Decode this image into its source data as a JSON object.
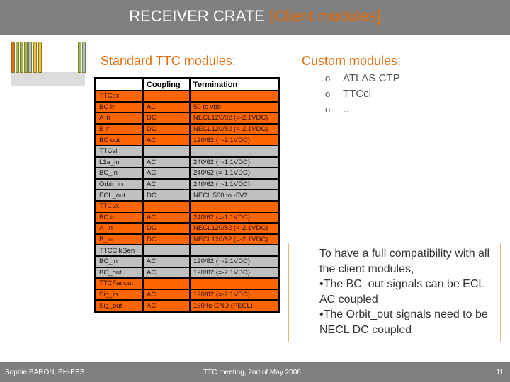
{
  "header": {
    "title_main": "RECEIVER CRATE",
    "title_accent": "[Client modules]"
  },
  "crate_image": {
    "icon": "vme-crate-illustration-icon",
    "slot_colors": [
      "#E46C0A",
      "#9BBB59",
      "#9BBB59",
      "#9BBB59",
      "#9DC3E6",
      "#F2C230",
      "#F2C230",
      "#9BBB59",
      "#9DC3E6"
    ]
  },
  "standard": {
    "heading": "Standard TTC modules:",
    "table": {
      "columns": [
        "",
        "Coupling",
        "Termination"
      ],
      "rows": [
        {
          "kind": "group",
          "color": "orange",
          "cells": [
            "TTCex",
            "",
            ""
          ]
        },
        {
          "kind": "signal",
          "color": "orange",
          "cells": [
            "BC in",
            "AC",
            "50 to vbb"
          ]
        },
        {
          "kind": "signal",
          "color": "orange",
          "cells": [
            "A in",
            "DC",
            "NECL120/82 (=-2.1VDC)"
          ]
        },
        {
          "kind": "signal",
          "color": "orange",
          "cells": [
            "B in",
            "DC",
            "NECL120/82 (=-2.1VDC)"
          ]
        },
        {
          "kind": "signal",
          "color": "orange",
          "cells": [
            "BC out",
            "AC",
            "120/82 (=-2.1VDC)"
          ]
        },
        {
          "kind": "group",
          "color": "gray",
          "cells": [
            "TTCvi",
            "",
            ""
          ]
        },
        {
          "kind": "signal",
          "color": "gray",
          "cells": [
            "L1a_in",
            "AC",
            "240/62 (=-1.1VDC)"
          ]
        },
        {
          "kind": "signal",
          "color": "gray",
          "cells": [
            "BC_in",
            "AC",
            "240/62 (=-1.1VDC)"
          ]
        },
        {
          "kind": "signal",
          "color": "gray",
          "cells": [
            "Orbit_in",
            "AC",
            "240/62 (=-1.1VDC)"
          ]
        },
        {
          "kind": "signal",
          "color": "gray",
          "cells": [
            "ECL_out",
            "DC",
            "NECL 560 to -5V2"
          ]
        },
        {
          "kind": "group",
          "color": "orange",
          "cells": [
            "TTCvx",
            "",
            ""
          ]
        },
        {
          "kind": "signal",
          "color": "orange",
          "cells": [
            "BC in",
            "AC",
            "240/62 (=-1.1VDC)"
          ]
        },
        {
          "kind": "signal",
          "color": "orange",
          "cells": [
            "A_in",
            "DC",
            "NECL120/82 (=-2.1VDC)"
          ]
        },
        {
          "kind": "signal",
          "color": "orange",
          "cells": [
            "B_in",
            "DC",
            "NECL120/82 (=-2.1VDC)"
          ]
        },
        {
          "kind": "group",
          "color": "gray",
          "cells": [
            "TTCClkGen",
            "",
            ""
          ]
        },
        {
          "kind": "signal",
          "color": "gray",
          "cells": [
            "BC_in",
            "AC",
            "120/82 (=-2.1VDC)"
          ]
        },
        {
          "kind": "signal",
          "color": "gray",
          "cells": [
            "BC_out",
            "AC",
            "120/82 (=-2.1VDC)"
          ]
        },
        {
          "kind": "group",
          "color": "orange",
          "cells": [
            "TTCFanout",
            "",
            ""
          ]
        },
        {
          "kind": "signal",
          "color": "orange",
          "cells": [
            "Sig_in",
            "AC",
            "120/82 (=-2.1VDC)"
          ]
        },
        {
          "kind": "signal",
          "color": "orange",
          "cells": [
            "Sig_out",
            "AC",
            "150 to GND (PECL)"
          ]
        }
      ]
    }
  },
  "custom": {
    "heading": "Custom modules:",
    "bullet": "o",
    "items": [
      "ATLAS CTP",
      "TTCci",
      ".."
    ]
  },
  "note": {
    "lines": [
      "To have a full compatibility with all the client modules,",
      "•The BC_out signals can be ECL AC coupled",
      "•The Orbit_out signals need to be NECL DC coupled"
    ]
  },
  "footer": {
    "author": "Sophie BARON, PH-ESS",
    "event": "TTC meeting, 2nd of May 2006",
    "page": "11"
  },
  "colors": {
    "accent": "#E46C0A",
    "orange_row": "#FF6600",
    "gray_row": "#C0C0C0",
    "bar": "#808080"
  }
}
